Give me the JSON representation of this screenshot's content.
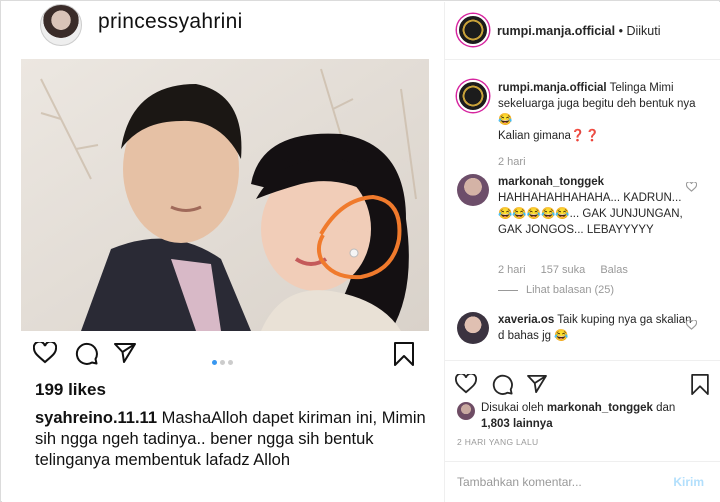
{
  "embedded_post": {
    "username": "princessyahrini",
    "likes": "199 likes",
    "caption_user": "syahreino.11.11",
    "caption_text": "MashaAlloh dapet kiriman ini, Mimin sih ngga ngeh tadinya.. bener ngga sih bentuk telinganya membentuk lafadz Alloh",
    "carousel_pages": 3,
    "carousel_active": 1
  },
  "post": {
    "header": {
      "username": "rumpi.manja.official",
      "separator": "•",
      "follow_status": "Diikuti"
    },
    "caption": {
      "username": "rumpi.manja.official",
      "text": "Telinga Mimi sekeluarga juga begitu deh bentuk nya😂\nKalian gimana❓❓",
      "time": "2 hari"
    },
    "comments": [
      {
        "username": "markonah_tonggek",
        "text": "HAHHAHAHHAHAHA... KADRUN... 😂😂😂😂😂... GAK JUNJUNGAN, GAK JONGOS... LEBAYYYYY",
        "time": "2 hari",
        "likes": "157 suka",
        "reply": "Balas",
        "view_replies": "Lihat balasan (25)"
      },
      {
        "username": "xaveria.os",
        "text": "Taik kuping nya ga skalian d bahas jg 😂"
      }
    ],
    "liked_by": {
      "prefix": "Disukai oleh",
      "user": "markonah_tonggek",
      "joiner": "dan",
      "others": "1,803 lainnya"
    },
    "time_ago": "2 HARI YANG LALU",
    "add_comment": {
      "placeholder": "Tambahkan komentar...",
      "post_label": "Kirim"
    }
  },
  "colors": {
    "accent": "#3897f0",
    "muted": "#999999",
    "border": "#dbdbdb",
    "post_disabled": "#b2dffc",
    "annotation": "#f07a2c"
  },
  "icons": [
    "heart-icon",
    "comment-icon",
    "share-icon",
    "bookmark-icon"
  ]
}
